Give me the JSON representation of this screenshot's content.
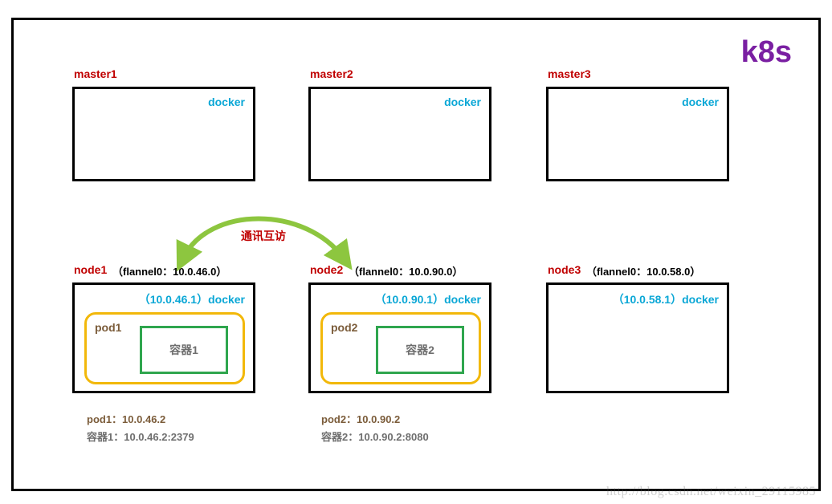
{
  "title": "k8s",
  "watermark": "http://blog.csdn.net/weixin_29115985",
  "comm_label": "通讯互访",
  "masters": [
    {
      "name": "master1",
      "docker": "docker"
    },
    {
      "name": "master2",
      "docker": "docker"
    },
    {
      "name": "master3",
      "docker": "docker"
    }
  ],
  "nodes": [
    {
      "name": "node1",
      "flannel": "（flannel0：10.0.46.0）",
      "docker_ip": "（10.0.46.1）docker",
      "pod_name": "pod1",
      "container_name": "容器1",
      "pod_addr": "pod1：10.0.46.2",
      "container_addr": "容器1：10.0.46.2:2379"
    },
    {
      "name": "node2",
      "flannel": "（flannel0：10.0.90.0）",
      "docker_ip": "（10.0.90.1）docker",
      "pod_name": "pod2",
      "container_name": "容器2",
      "pod_addr": "pod2：10.0.90.2",
      "container_addr": "容器2：10.0.90.2:8080"
    },
    {
      "name": "node3",
      "flannel": "（flannel0：10.0.58.0）",
      "docker_ip": "（10.0.58.1）docker"
    }
  ]
}
